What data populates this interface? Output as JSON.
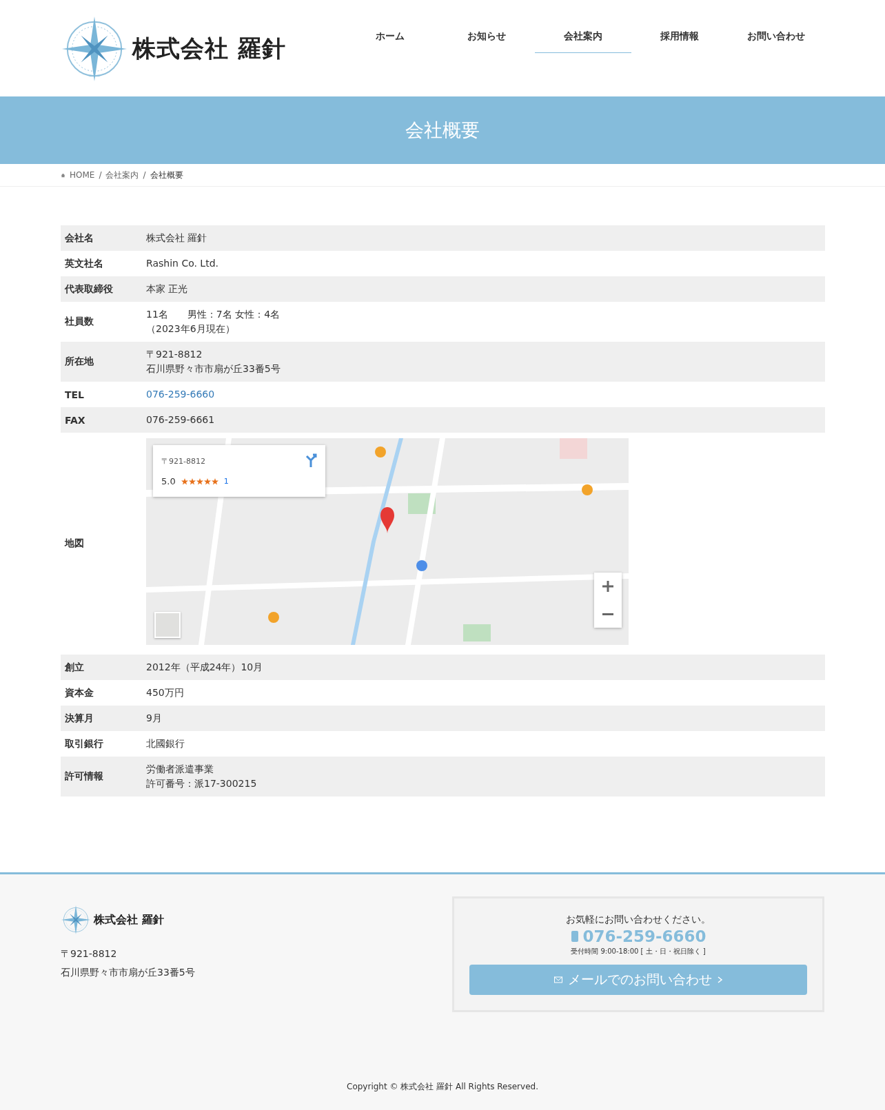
{
  "header": {
    "logo_text": "株式会社 羅針",
    "nav": [
      {
        "label": "ホーム",
        "selected": false
      },
      {
        "label": "お知らせ",
        "selected": false
      },
      {
        "label": "会社案内",
        "selected": true
      },
      {
        "label": "採用情報",
        "selected": false
      },
      {
        "label": "お問い合わせ",
        "selected": false
      }
    ]
  },
  "banner": {
    "title": "会社概要"
  },
  "breadcrumb_separator": "/",
  "breadcrumb": [
    {
      "label": "HOME",
      "kind": "home"
    },
    {
      "label": "会社案内",
      "kind": "link"
    },
    {
      "label": "会社概要",
      "kind": "current"
    }
  ],
  "table": {
    "rows": [
      {
        "label": "会社名",
        "lines": [
          "株式会社 羅針"
        ],
        "kind": "text"
      },
      {
        "label": "英文社名",
        "lines": [
          "Rashin Co. Ltd."
        ],
        "kind": "text"
      },
      {
        "label": "代表取締役",
        "lines": [
          "本家 正光"
        ],
        "kind": "text"
      },
      {
        "label": "社員数",
        "lines": [
          "11名　　男性：7名 女性：4名",
          "（2023年6月現在）"
        ],
        "kind": "text"
      },
      {
        "label": "所在地",
        "lines": [
          "〒921-8812",
          "石川県野々市市扇が丘33番5号"
        ],
        "kind": "text"
      },
      {
        "label": "TEL",
        "lines": [
          "076-259-6660"
        ],
        "kind": "link"
      },
      {
        "label": "FAX",
        "lines": [
          "076-259-6661"
        ],
        "kind": "text"
      },
      {
        "label": "地図",
        "kind": "map",
        "map": {
          "kind": "picture",
          "card": {
            "postal": "〒921-8812",
            "rating": "5.0",
            "stars": 5,
            "reviews": "1"
          }
        }
      },
      {
        "label": "創立",
        "lines": [
          "2012年（平成24年）10月"
        ],
        "kind": "text"
      },
      {
        "label": "資本金",
        "lines": [
          "450万円"
        ],
        "kind": "text"
      },
      {
        "label": "決算月",
        "lines": [
          "9月"
        ],
        "kind": "text"
      },
      {
        "label": "取引銀行",
        "lines": [
          "北國銀行"
        ],
        "kind": "text"
      },
      {
        "label": "許可情報",
        "lines": [
          "労働者派遣事業",
          "許可番号：派17-300215"
        ],
        "kind": "text"
      }
    ]
  },
  "footer": {
    "logo_text": "株式会社 羅針",
    "address": [
      "〒921-8812",
      "石川県野々市市扇が丘33番5号"
    ],
    "contact": {
      "lead": "お気軽にお問い合わせください。",
      "phone": "076-259-6660",
      "hours": "受付時間 9:00-18:00 [ 土・日・祝日除く ]",
      "mail_button": "メールでのお問い合わせ"
    },
    "copyright": "Copyright © 株式会社 羅針 All Rights Reserved."
  }
}
